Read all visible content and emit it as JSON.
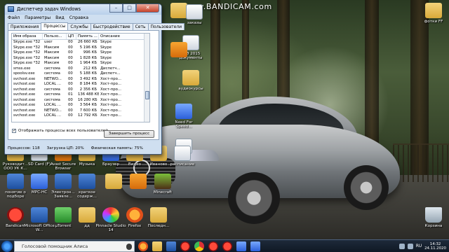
{
  "watermark": "www.BANDICAM.com",
  "task_manager": {
    "title": "Диспетчер задач Windows",
    "window_buttons": {
      "minimize": "–",
      "maximize": "□",
      "close": "✕"
    },
    "menu": [
      "Файл",
      "Параметры",
      "Вид",
      "Справка"
    ],
    "tabs": [
      "Приложения",
      "Процессы",
      "Службы",
      "Быстродействие",
      "Сеть",
      "Пользователи"
    ],
    "active_tab": "Процессы",
    "columns": [
      "Имя образа",
      "Пользо...",
      "ЦП",
      "Память ...",
      "Описание"
    ],
    "rows": [
      [
        "Skype.exe *32",
        "user",
        "00",
        "26 660 КБ",
        "Skype"
      ],
      [
        "Skype.exe *32",
        "Максим",
        "00",
        "5 196 КБ",
        "Skype"
      ],
      [
        "Skype.exe *32",
        "Максим",
        "00",
        "996 КБ",
        "Skype"
      ],
      [
        "Skype.exe *32",
        "Максим",
        "00",
        "1 828 КБ",
        "Skype"
      ],
      [
        "Skype.exe *32",
        "Максим",
        "00",
        "1 964 КБ",
        "Skype"
      ],
      [
        "smss.exe",
        "система",
        "00",
        "212 КБ",
        "Диспетч..."
      ],
      [
        "spoolsv.exe",
        "система",
        "00",
        "5 188 КБ",
        "Диспетч..."
      ],
      [
        "svchost.exe",
        "NETWO...",
        "00",
        "3 492 КБ",
        "Хост-про..."
      ],
      [
        "svchost.exe",
        "LOCAL ...",
        "00",
        "8 184 КБ",
        "Хост-про..."
      ],
      [
        "svchost.exe",
        "система",
        "00",
        "2 356 КБ",
        "Хост-про..."
      ],
      [
        "svchost.exe",
        "система",
        "01",
        "136 488 КБ",
        "Хост-про..."
      ],
      [
        "svchost.exe",
        "система",
        "00",
        "16 280 КБ",
        "Хост-про..."
      ],
      [
        "svchost.exe",
        "LOCAL ...",
        "00",
        "3 564 КБ",
        "Хост-про..."
      ],
      [
        "svchost.exe",
        "NETWO...",
        "00",
        "7 600 КБ",
        "Хост-про..."
      ],
      [
        "svchost.exe",
        "LOCAL ...",
        "00",
        "12 792 КБ",
        "Хост-про..."
      ]
    ],
    "show_all_checkbox": {
      "label": "Отображать процессы всех пользователей",
      "checked": true
    },
    "end_process_button": "Завершить процесс",
    "status": {
      "processes": "Процессов: 118",
      "cpu": "Загрузка ЦП: 20%",
      "memory": "Физическая память: 75%"
    }
  },
  "desktop_icons": [
    {
      "id": "empty-folder",
      "label": "",
      "icon": "folder-icon"
    },
    {
      "id": "zakaz",
      "label": "заказы",
      "icon": "file-icon"
    },
    {
      "id": "scans",
      "label": "ЕГЭ 2015 документы",
      "icon": "file-icon"
    },
    {
      "id": "audiokursy",
      "label": "аудиокурсы",
      "icon": "folder-icon"
    },
    {
      "id": "nfs",
      "label": "Need For Speed...",
      "icon": "nfs-icon"
    },
    {
      "id": "foto",
      "label": "фотки FF",
      "icon": "folder-icon"
    },
    {
      "id": "file1",
      "label": "",
      "icon": "file-icon"
    },
    {
      "id": "file2",
      "label": "",
      "icon": "file-icon"
    },
    {
      "id": "ruk",
      "label": "Руководит... ООО УК К...",
      "icon": "folder-icon"
    },
    {
      "id": "sd",
      "label": "SD Card (F)",
      "icon": "drive-icon"
    },
    {
      "id": "avast",
      "label": "Avast Secure Browser",
      "icon": "avast-icon"
    },
    {
      "id": "music",
      "label": "Музыка",
      "icon": "folder-icon"
    },
    {
      "id": "bro",
      "label": "Браузер",
      "icon": "browser-icon"
    },
    {
      "id": "vid",
      "label": "Видео",
      "icon": "folder-icon"
    },
    {
      "id": "ivan",
      "label": "Иваново",
      "icon": "folder-icon"
    },
    {
      "id": "rasp",
      "label": "расписание",
      "icon": "file-icon"
    },
    {
      "id": "pon",
      "label": "понятие о подборе",
      "icon": "file-icon"
    },
    {
      "id": "mpc",
      "label": "MPC-HC",
      "icon": "mpc-icon"
    },
    {
      "id": "el",
      "label": "Электрон... Заявле...",
      "icon": "file-icon"
    },
    {
      "id": "kr",
      "label": "краткое содерж...",
      "icon": "file-icon"
    },
    {
      "id": "gallery",
      "label": "",
      "icon": "gallery-icon"
    },
    {
      "id": "orange",
      "label": "",
      "icon": "orange-icon"
    },
    {
      "id": "mc",
      "label": "Minecraft",
      "icon": "minecraft-icon"
    },
    {
      "id": "bandicam",
      "label": "Bandicam",
      "icon": "bandicam-icon"
    },
    {
      "id": "word",
      "label": "Microsoft Office W...",
      "icon": "word-icon"
    },
    {
      "id": "utorrent",
      "label": "µTorrent",
      "icon": "utorrent-icon"
    },
    {
      "id": "dd",
      "label": "дд",
      "icon": "folder-icon"
    },
    {
      "id": "pinnacle",
      "label": "Pinnacle Studio 14",
      "icon": "pinnacle-icon"
    },
    {
      "id": "firefox",
      "label": "Firefox",
      "icon": "firefox-icon"
    },
    {
      "id": "last",
      "label": "Последн...",
      "icon": "folder-icon"
    },
    {
      "id": "recycle",
      "label": "Корзина",
      "icon": "recycle-bin-icon"
    }
  ],
  "taskbar": {
    "search_text": "Голосовой помощник Алиса",
    "apps": [
      "firefox-icon",
      "folder-icon",
      "word-icon",
      "yandex-icon",
      "chrome-icon",
      "opera-icon",
      "bandicam-icon",
      "photo-icon",
      "skype-icon"
    ],
    "language": "RU",
    "time": "14:32",
    "date": "24.11.2020"
  },
  "colors": {
    "titlebar": "#b9d0ea",
    "taskbar": "#0f1824",
    "close_button": "#c7432b"
  }
}
